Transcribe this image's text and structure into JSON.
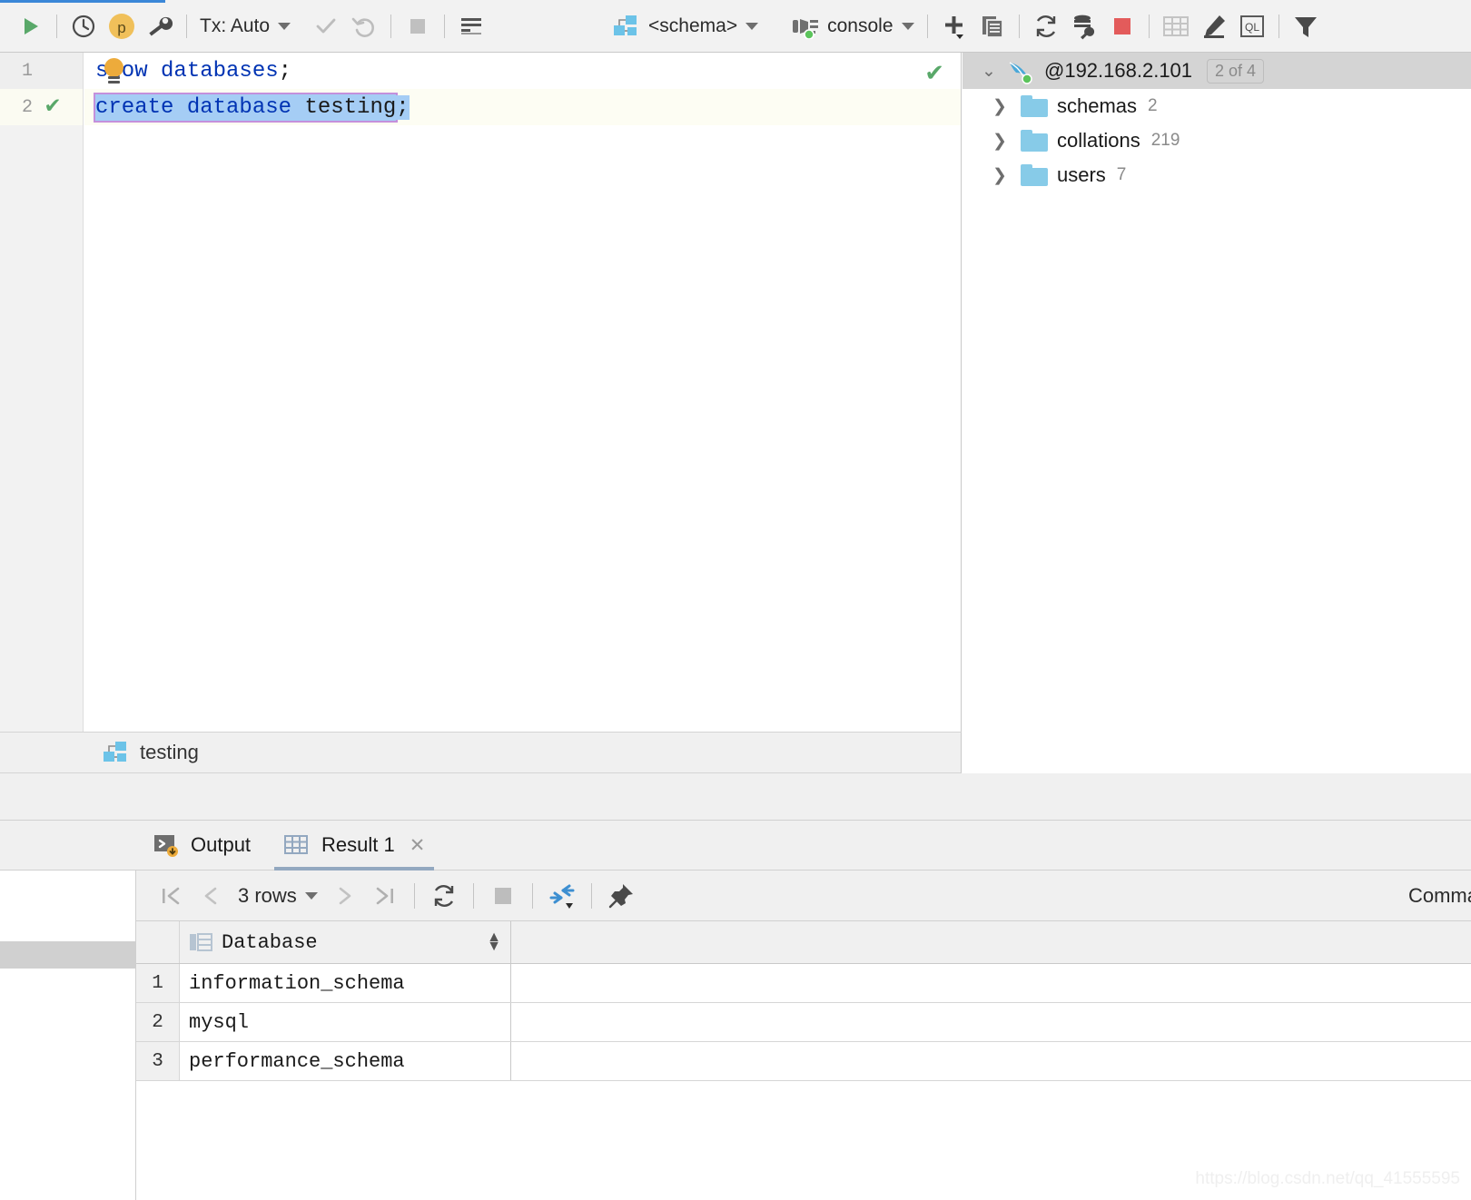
{
  "toolbar": {
    "run_title": "Run",
    "history_title": "History",
    "profile_title": "p",
    "settings_title": "Data Source Properties",
    "tx_label": "Tx: Auto",
    "commit_title": "Commit",
    "rollback_title": "Rollback",
    "stop_title": "Stop",
    "params_title": "Parameters",
    "schema_label": "<schema>",
    "session_label": "console",
    "add_title": "New",
    "duplicate_title": "Duplicate",
    "refresh_title": "Refresh",
    "modify_title": "Modify Data Source",
    "terminate_title": "Terminate",
    "table_title": "Open Table Editor",
    "edit_title": "Edit",
    "ql_title": "Query Console",
    "filter_title": "Filter"
  },
  "editor": {
    "lines": [
      {
        "number": "1",
        "marker": "",
        "segments": [
          {
            "text": "show",
            "style": "kw"
          },
          {
            "text": " databases",
            "style": "kw"
          },
          {
            "text": ";",
            "style": "plain"
          }
        ]
      },
      {
        "number": "2",
        "marker": "✔",
        "segments": [
          {
            "text": "create database ",
            "style": "kw"
          },
          {
            "text": "testing",
            "style": "plain"
          },
          {
            "text": ";",
            "style": "plain"
          }
        ]
      }
    ],
    "line1_number": "1",
    "line2_number": "2",
    "line2_marker": "✔",
    "line1_kw": "show",
    "line1_rest": " databases",
    "line1_semi": ";",
    "line2_kw": "create database ",
    "line2_name": "testing",
    "line2_semi": ";",
    "status_check": "✔"
  },
  "breadcrumb": {
    "label": "testing"
  },
  "tree": {
    "root": {
      "name": "@192.168.2.101",
      "badge": "2 of 4"
    },
    "items": [
      {
        "name": "schemas",
        "count": "2"
      },
      {
        "name": "collations",
        "count": "219"
      },
      {
        "name": "users",
        "count": "7"
      }
    ]
  },
  "results": {
    "tabs": [
      {
        "label": "Output",
        "icon": "console-icon",
        "active": false,
        "closable": false
      },
      {
        "label": "Result 1",
        "icon": "table-icon",
        "active": true,
        "closable": true,
        "close": "✕"
      }
    ],
    "toolbar": {
      "first_page": "|‹",
      "prev_page": "‹",
      "rows_label": "3 rows",
      "next_page": "›",
      "last_page": "›|",
      "reload_title": "Reload Page",
      "stop_title": "Stop",
      "compare_title": "Transpose",
      "pin_title": "Pin Tab",
      "right_label": "Comma"
    },
    "grid": {
      "columns": [
        "Database"
      ],
      "rows": [
        {
          "index": "1",
          "Database": "information_schema"
        },
        {
          "index": "2",
          "Database": "mysql"
        },
        {
          "index": "3",
          "Database": "performance_schema"
        }
      ]
    }
  },
  "watermark": "https://blog.csdn.net/qq_41555595",
  "colors": {
    "accent": "#3b87d8",
    "keyword": "#0033b3",
    "selection": "#a5cdf5",
    "selection_border": "#c490dc",
    "green": "#59a869",
    "red": "#e35b5b",
    "folder": "#87cbe8",
    "amber": "#edab3b"
  }
}
